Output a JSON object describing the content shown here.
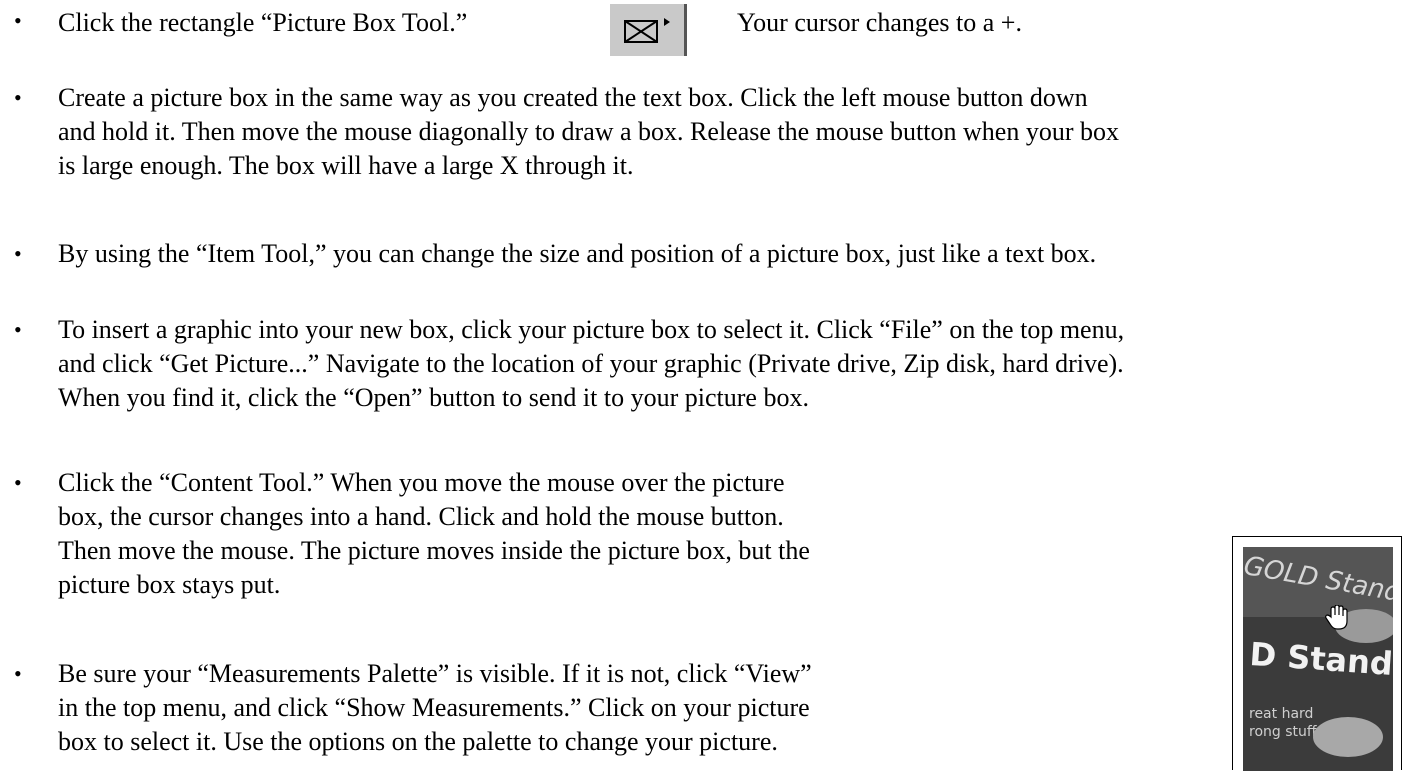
{
  "bullet_symbol": "•",
  "items": [
    {
      "lines": [
        "Click the rectangle “Picture Box Tool.”"
      ],
      "after_icon": "Your cursor changes to a +.",
      "icon": "picture-box-tool-icon"
    },
    {
      "lines": [
        "Create a picture box in the same way as you created the text box.  Click the left mouse button down",
        "and hold it.  Then move the mouse diagonally to draw a box.  Release the mouse button when your box",
        "is large enough.  The box will have a large X through it."
      ]
    },
    {
      "lines": [
        "By using the “Item Tool,” you can change the size and position of a picture box, just like a text box."
      ]
    },
    {
      "lines": [
        "To insert a graphic into your new box, click your picture box to select it.  Click “File” on the top menu,",
        "and click “Get Picture...”  Navigate to the location of your graphic (Private drive, Zip disk, hard drive).",
        "When you find it, click the “Open” button to send it to your picture box."
      ]
    },
    {
      "lines": [
        "Click the “Content Tool.”  When you move the mouse over the picture",
        "box, the cursor changes into a hand.  Click and hold the mouse button.",
        "Then move the mouse.  The picture moves inside the picture box, but the",
        "picture box stays put."
      ]
    },
    {
      "lines": [
        "Be sure your “Measurements Palette” is visible.  If it is not, click “View”",
        "in the top menu, and click “Show Measurements.”  Click on your picture",
        "box to select it.  Use the options on the palette to change your picture."
      ]
    }
  ],
  "photo": {
    "logo_text": "GOLD Standard",
    "main_text": "D Standard",
    "small_line_1": "reat hard",
    "small_line_2": "rong stuff",
    "cursor_icon": "hand-cursor-icon"
  }
}
